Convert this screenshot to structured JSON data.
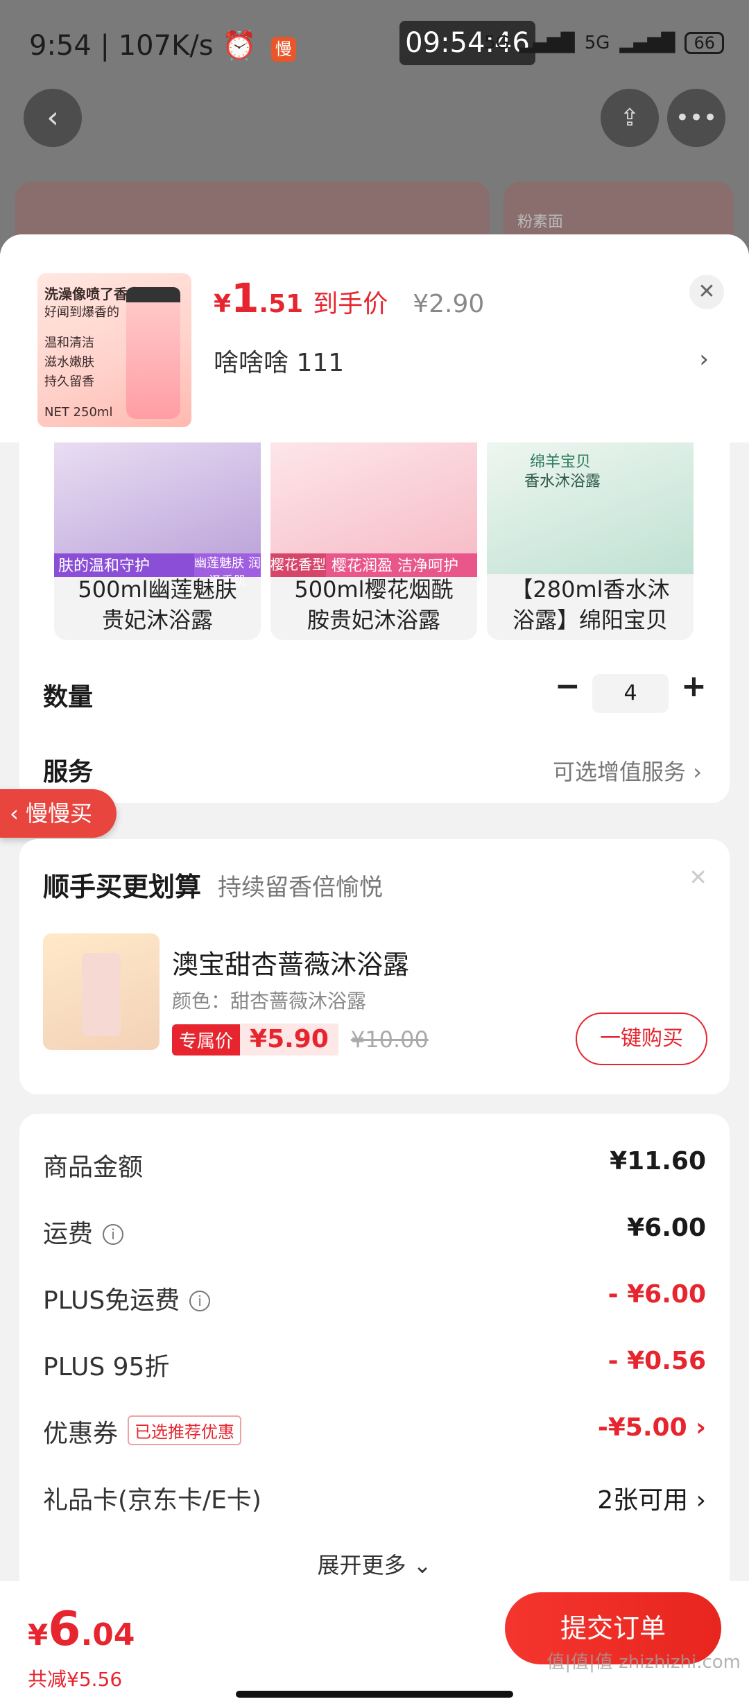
{
  "status_bar": {
    "time": "9:54",
    "net_speed": "107K/s",
    "slow_badge": "慢",
    "clock_overlay": "09:54:46",
    "signal1": "5G",
    "signal2": "5G",
    "battery": "66"
  },
  "background": {
    "card_text": "粉素面"
  },
  "product": {
    "thumb_lines": [
      "洗澡像喷了香水",
      "好闻到爆香的",
      "温和清洁",
      "滋水嫩肤",
      "持久留香",
      "NET 250ml"
    ],
    "price_currency": "¥",
    "price_int": "1",
    "price_dec": ".51",
    "price_label": "到手价",
    "original_price": "¥2.90",
    "variant": "啥啥啥  111"
  },
  "recommendations": [
    {
      "name_line1": "500ml幽莲魅肤",
      "name_line2": "贵妃沐浴露",
      "tag_a": "肤的温和守护",
      "tag_b": "幽莲魅肤 润泽香肌"
    },
    {
      "name_line1": "500ml樱花烟酰",
      "name_line2": "胺贵妃沐浴露",
      "tag_a": "樱花香型",
      "tag_b": "樱花润盈 洁净呵护"
    },
    {
      "name_line1": "【280ml香水沐",
      "name_line2": "浴露】绵阳宝贝",
      "tag_a": "绵羊宝贝",
      "tag_b": "香水沐浴露"
    }
  ],
  "slow_buy": "慢慢买",
  "quantity": {
    "label": "数量",
    "value": "4",
    "minus": "−",
    "plus": "+"
  },
  "service": {
    "label": "服务",
    "value": "可选增值服务 ›"
  },
  "addon": {
    "title": "顺手买更划算",
    "subtitle": "持续留香倍愉悦",
    "name": "澳宝甜杏蔷薇沐浴露",
    "color": "颜色：甜杏蔷薇沐浴露",
    "price_tag": "专属价",
    "price": "¥5.90",
    "orig_price": "¥10.00",
    "buy_button": "一键购买"
  },
  "fees": {
    "goods_label": "商品金额",
    "goods_value": "¥11.60",
    "shipping_label": "运费",
    "shipping_value": "¥6.00",
    "plus_ship_label": "PLUS免运费",
    "plus_ship_value": "- ¥6.00",
    "plus95_label": "PLUS 95折",
    "plus95_value": "- ¥0.56",
    "coupon_label": "优惠券",
    "coupon_badge": "已选推荐优惠",
    "coupon_value": "-¥5.00 ›",
    "giftcard_label": "礼品卡(京东卡/E卡)",
    "giftcard_value": "2张可用 ›",
    "more": "展开更多 ⌄"
  },
  "footer": {
    "currency": "¥",
    "total_int": "6",
    "total_dec": ".04",
    "saved": "共减¥5.56",
    "submit": "提交订单",
    "watermark": "值|值|值 zhizhizhi.com"
  }
}
